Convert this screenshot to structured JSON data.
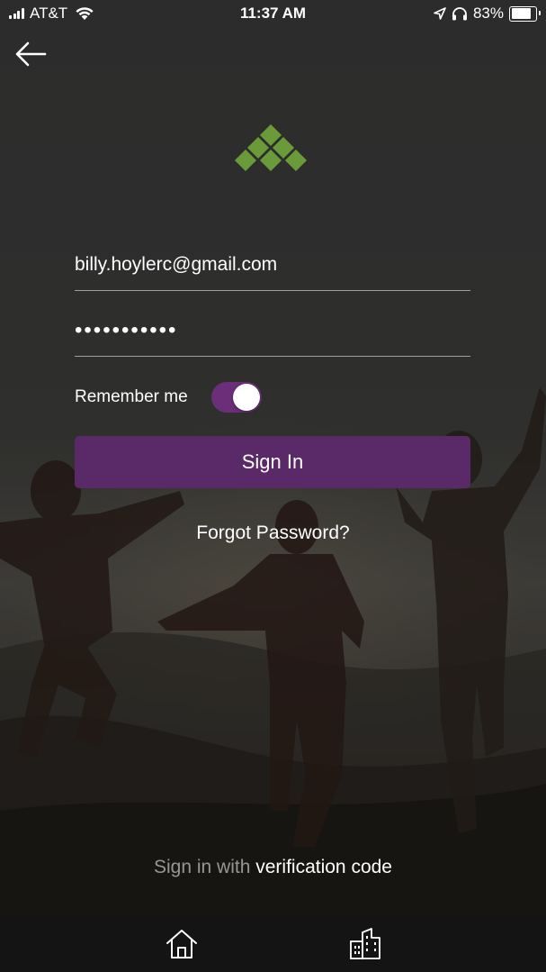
{
  "status_bar": {
    "carrier": "AT&T",
    "time": "11:37 AM",
    "battery_percent": "83%",
    "battery_level": 0.83,
    "icons": [
      "signal-icon",
      "wifi-icon",
      "location-icon",
      "headphones-icon",
      "battery-icon"
    ]
  },
  "header": {
    "back_icon": "arrow-left-icon"
  },
  "login": {
    "email_value": "billy.hoylerc@gmail.com",
    "password_value": "•••••••••••",
    "remember_label": "Remember me",
    "remember_on": true,
    "sign_in_label": "Sign In",
    "forgot_label": "Forgot Password?",
    "verification_prefix": "Sign in with",
    "verification_link": "verification code"
  },
  "bottom_nav": {
    "items": [
      "home-icon",
      "buildings-icon"
    ]
  },
  "colors": {
    "accent_purple": "#5a2a68",
    "toggle_purple": "#6b2f7a",
    "logo_green": "#6a9a3a",
    "bottom_bar": "#141414"
  }
}
